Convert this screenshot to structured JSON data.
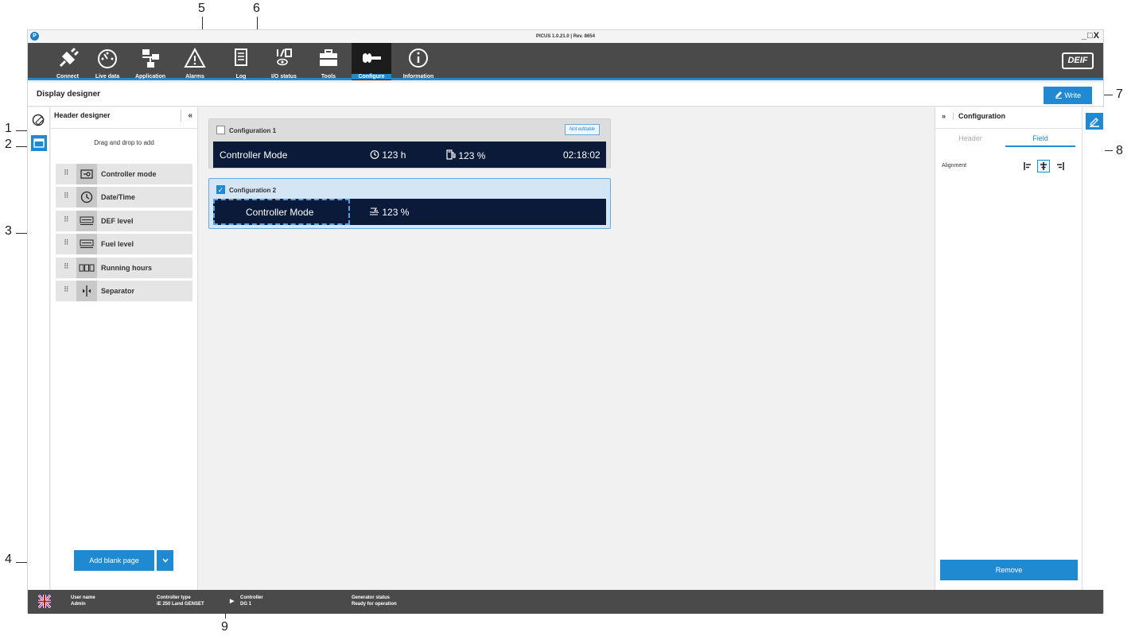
{
  "callouts": [
    "1",
    "2",
    "3",
    "4",
    "5",
    "6",
    "7",
    "8",
    "9"
  ],
  "window": {
    "title": "PICUS 1.0.21.0 | Rev. 8654",
    "controls": "_□X"
  },
  "nav": {
    "items": [
      {
        "label": "Connect",
        "icon": "plug-icon"
      },
      {
        "label": "Live data",
        "icon": "gauge-icon"
      },
      {
        "label": "Application",
        "icon": "application-icon"
      },
      {
        "label": "Alarms",
        "icon": "warning-icon"
      },
      {
        "label": "Log",
        "icon": "log-icon"
      },
      {
        "label": "I/O status",
        "icon": "io-status-icon"
      },
      {
        "label": "Tools",
        "icon": "toolbox-icon"
      },
      {
        "label": "Configure",
        "icon": "wrench-icon",
        "active": true
      },
      {
        "label": "Information",
        "icon": "info-icon"
      }
    ],
    "brand": "DEIF"
  },
  "page": {
    "title": "Display designer",
    "write_label": "Write"
  },
  "header_designer": {
    "title": "Header designer",
    "collapse": "«",
    "hint": "Drag and drop to add",
    "items": [
      {
        "label": "Controller mode",
        "icon": "controller-mode-icon"
      },
      {
        "label": "Date/Time",
        "icon": "clock-icon"
      },
      {
        "label": "DEF level",
        "icon": "def-level-icon"
      },
      {
        "label": "Fuel level",
        "icon": "fuel-level-icon"
      },
      {
        "label": "Running hours",
        "icon": "running-hours-icon"
      },
      {
        "label": "Separator",
        "icon": "separator-icon"
      }
    ],
    "add_blank_label": "Add blank page",
    "add_blank_caret": "⌄"
  },
  "configs": [
    {
      "title": "Configuration 1",
      "checked": false,
      "badge": "Not editable",
      "fields": {
        "mode": "Controller Mode",
        "hours": "123 h",
        "fuel": "123 %",
        "time": "02:18:02"
      }
    },
    {
      "title": "Configuration 2",
      "checked": true,
      "fields": {
        "mode": "Controller Mode",
        "def": "123 %"
      }
    }
  ],
  "config_panel": {
    "expand": "»",
    "title": "Configuration",
    "tabs": [
      "Header",
      "Field"
    ],
    "active_tab": "Field",
    "alignment_label": "Alignment",
    "alignment_active": "center",
    "remove_label": "Remove"
  },
  "status": {
    "user_label": "User name",
    "user_value": "Admin",
    "ctrl_type_label": "Controller type",
    "ctrl_type_value": "iE 250 Land GENSET",
    "controller_label": "Controller",
    "controller_value": "DG 1",
    "gen_status_label": "Generator status",
    "gen_status_value": "Ready for operation"
  },
  "colors": {
    "accent": "#1f8ad2",
    "nav_bg": "#4a4a4a",
    "display_bg": "#0b1a38"
  }
}
